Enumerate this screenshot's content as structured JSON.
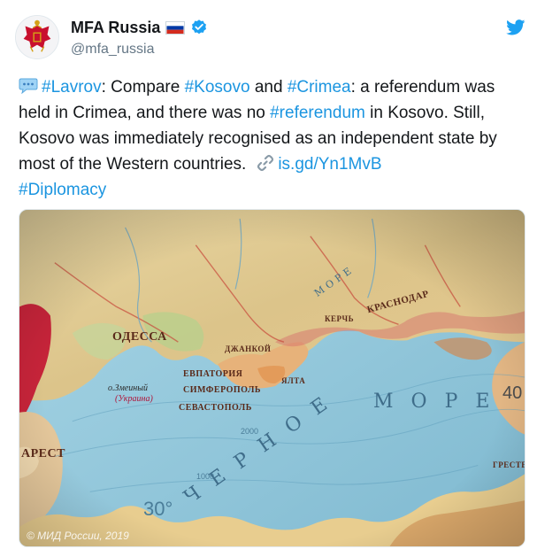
{
  "tweet": {
    "display_name": "MFA Russia",
    "handle": "@mfa_russia",
    "segments": [
      {
        "type": "tag",
        "text": "#Lavrov"
      },
      {
        "type": "text",
        "text": ": Compare "
      },
      {
        "type": "tag",
        "text": "#Kosovo"
      },
      {
        "type": "text",
        "text": " and "
      },
      {
        "type": "tag",
        "text": "#Crimea"
      },
      {
        "type": "text",
        "text": ": a referendum was held in Crimea, and there was no "
      },
      {
        "type": "tag",
        "text": "#referendum"
      },
      {
        "type": "text",
        "text": " in Kosovo. Still, Kosovo was immediately recognised as an independent state by most of the Western countries."
      }
    ],
    "link_text": "is.gd/Yn1MvB",
    "trailing_tag": "#Diplomacy"
  },
  "media": {
    "watermark": "© МИД России, 2019",
    "map_labels": {
      "odessa": "ОДЕССА",
      "evpatoria": "ЕВПАТОРИЯ",
      "simferopol": "СИМФЕРОПОЛЬ",
      "sevastopol": "СЕВАСТОПОЛЬ",
      "dzhankoi": "ДЖАНКОЙ",
      "kerch": "КЕРЧЬ",
      "krasnodar": "КРАСНОДАР",
      "yalta": "ЯЛТА",
      "zmeiny": "о.Змеиный",
      "ukraina": "(Украина)",
      "sea_black": "ЧЕРНОЕ",
      "sea_more": "МОРЕ",
      "sea_azov": "МОРЕ",
      "depth_2000": "2000",
      "depth_1000": "1000",
      "lat_30": "30°",
      "lat_40": "40",
      "arest": "АРЕСТ",
      "greece": "ГРЕСТЕ"
    }
  },
  "colors": {
    "text": "#14171a",
    "link": "#1b95e0",
    "secondary": "#657786",
    "verified": "#1da1f2",
    "twitter_bird": "#1da1f2"
  },
  "icons": [
    "bubble-icon",
    "verified-icon",
    "twitter-bird-icon",
    "link-icon",
    "flag-icon"
  ]
}
